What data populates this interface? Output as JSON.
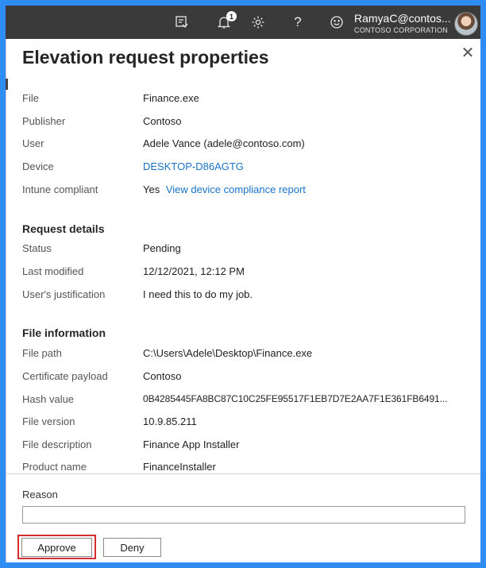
{
  "topbar": {
    "notification_count": "1",
    "user_name": "RamyaC@contos...",
    "user_org": "CONTOSO CORPORATION",
    "icons": [
      "feedback-icon",
      "bell-icon",
      "gear-icon",
      "help-icon",
      "smiley-icon"
    ],
    "help_glyph": "?"
  },
  "panel": {
    "title": "Elevation request properties",
    "close_glyph": "✕",
    "overview": [
      {
        "label": "File",
        "value": "Finance.exe"
      },
      {
        "label": "Publisher",
        "value": "Contoso"
      },
      {
        "label": "User",
        "value": "Adele Vance (adele@contoso.com)"
      },
      {
        "label": "Device",
        "value": "DESKTOP-D86AGTG"
      },
      {
        "label": "Intune compliant",
        "value": "Yes",
        "link": "View device compliance report"
      }
    ],
    "request_details": {
      "heading": "Request details",
      "rows": [
        {
          "label": "Status",
          "value": "Pending"
        },
        {
          "label": "Last modified",
          "value": "12/12/2021, 12:12 PM"
        },
        {
          "label": "User's justification",
          "value": "I need this to do my job."
        }
      ]
    },
    "file_information": {
      "heading": "File information",
      "rows": [
        {
          "label": "File path",
          "value": "C:\\Users\\Adele\\Desktop\\Finance.exe"
        },
        {
          "label": "Certificate payload",
          "value": "Contoso"
        },
        {
          "label": "Hash value",
          "value": "0B4285445FA8BC87C10C25FE95517F1EB7D7E2AA7F1E361FB6491..."
        },
        {
          "label": "File version",
          "value": "10.9.85.211"
        },
        {
          "label": "File description",
          "value": "Finance App Installer"
        },
        {
          "label": "Product name",
          "value": "FinanceInstaller"
        }
      ]
    }
  },
  "footer": {
    "reason_label": "Reason",
    "reason_value": "",
    "approve_label": "Approve",
    "deny_label": "Deny"
  },
  "colors": {
    "frame_border": "#2f8cf3",
    "topbar_bg": "#3a3a3a",
    "link": "#1a73c7",
    "highlight": "#d32f2f"
  }
}
